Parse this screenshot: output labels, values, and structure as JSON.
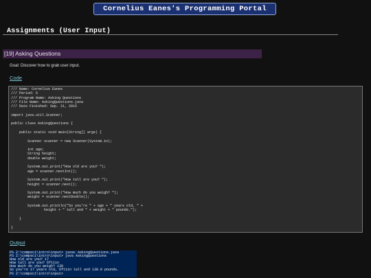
{
  "header": {
    "portal_title": "Cornelius Eanes's Programming Portal"
  },
  "section": {
    "title": "Assignments (User Input)"
  },
  "lesson": {
    "title": "[19] Asking Questions",
    "goal": "Goal: Discover how to grab user input."
  },
  "code_section": {
    "link_label": "Code",
    "lines": [
      "/// Name: Cornelius Eanes",
      "/// Period: 5",
      "/// Program Name: Asking Questions",
      "/// File Name: AskingQuestions.java",
      "/// Date Finished: Sep. 21, 2015",
      "",
      "import java.util.Scanner;",
      "",
      "public class AskingQuestions {",
      "",
      "    public static void main(String[] args) {",
      "",
      "        Scanner scanner = new Scanner(System.in);",
      "",
      "        int age;",
      "        String height;",
      "        double weight;",
      "",
      "        System.out.print(\"How old are you? \");",
      "        age = scanner.nextInt();",
      "",
      "        System.out.print(\"How tall are you? \");",
      "        height = scanner.next();",
      "",
      "        System.out.print(\"How much do you weigh? \");",
      "        weight = scanner.nextDouble();",
      "",
      "        System.out.println(\"So you're \" + age + \" years old, \" +",
      "                height + \" tall and \" + weight + \" pounds.\");",
      "",
      "    }",
      "",
      "}"
    ]
  },
  "output_section": {
    "link_label": "Output",
    "terminal_lines": [
      "PS Z:\\compsci\\intro\\input> javac AskingQuestions.java",
      "PS Z:\\compsci\\intro\\input> java AskingQuestions",
      "How old are you? 17",
      "How tall are you? 6ft1in",
      "How much do you weigh? 130",
      "So you're 17 years old, 6ft1in tall and 130.0 pounds.",
      "PS Z:\\compsci\\intro\\input>"
    ]
  },
  "colors": {
    "page_background": "#111111",
    "banner_background": "#1a3070",
    "lesson_bar": "#3c2246",
    "code_background": "#2b2b2b",
    "terminal_background": "#012456",
    "link": "#7ec8d8"
  }
}
